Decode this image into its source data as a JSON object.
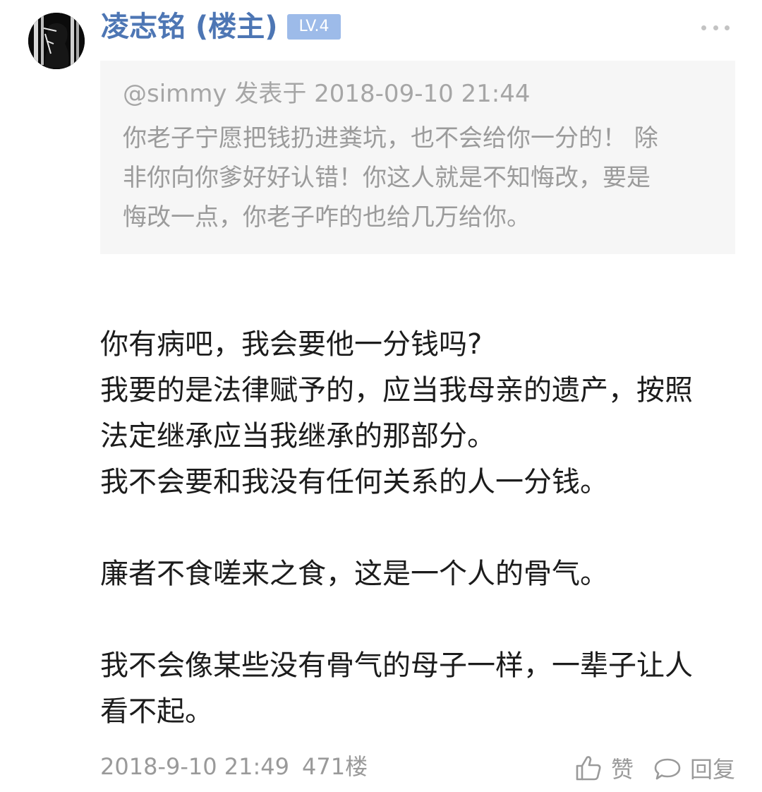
{
  "post": {
    "author": "凌志铭 (楼主)",
    "level": "LV.4",
    "quote": {
      "meta": "@simmy 发表于 2018-09-10 21:44",
      "lines": [
        "你老子宁愿把钱扔进粪坑，也不会给你一分的！ 除",
        "非你向你爹好好认错！你这人就是不知悔改，要是",
        "悔改一点，你老子咋的也给几万给你。"
      ]
    },
    "body": [
      "你有病吧，我会要他一分钱吗?",
      "我要的是法律赋予的，应当我母亲的遗产，按照",
      "法定继承应当我继承的那部分。",
      "我不会要和我没有任何关系的人一分钱。",
      "",
      "廉者不食嗟来之食，这是一个人的骨气。",
      "",
      "我不会像某些没有骨气的母子一样，一辈子让人",
      "看不起。"
    ],
    "timestamp": "2018-9-10 21:49",
    "floor": "471楼"
  },
  "actions": {
    "like_label": "赞",
    "reply_label": "回复"
  },
  "icons": {
    "more": "more-dots-icon",
    "like": "thumb-up-icon",
    "reply": "comment-bubble-icon"
  },
  "colors": {
    "username": "#4d76b4",
    "badge": "#9dbbe9",
    "quote_bg": "#f6f6f6",
    "muted": "#9a9a9a"
  }
}
